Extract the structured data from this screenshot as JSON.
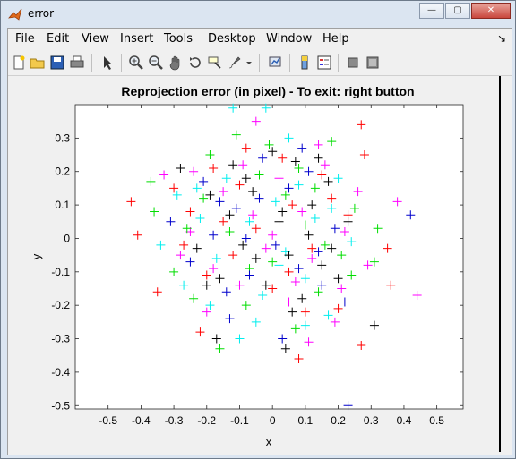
{
  "window": {
    "title": "error"
  },
  "title_buttons": {
    "minimize": "—",
    "maximize": "▢",
    "close": "✕"
  },
  "menu": [
    "File",
    "Edit",
    "View",
    "Insert",
    "Tools",
    "Desktop",
    "Window",
    "Help"
  ],
  "menu_arrow": "↘",
  "toolbar": {
    "tools": [
      "new-figure-icon",
      "open-icon",
      "save-icon",
      "print-icon",
      "pointer-icon",
      "zoom-in-icon",
      "zoom-out-icon",
      "pan-icon",
      "rotate-icon",
      "data-cursor-icon",
      "brush-icon",
      "link-icon",
      "colorbar-icon",
      "legend-icon",
      "hide-plot-tools-icon",
      "show-plot-tools-icon"
    ]
  },
  "chart_data": {
    "type": "scatter",
    "title": "Reprojection error (in pixel) - To exit: right button",
    "xlabel": "x",
    "ylabel": "y",
    "xlim": [
      -0.6,
      0.58
    ],
    "ylim": [
      -0.51,
      0.4
    ],
    "xticks": [
      "-0.5",
      "-0.4",
      "-0.3",
      "-0.2",
      "-0.1",
      "0",
      "0.1",
      "0.2",
      "0.3",
      "0.4",
      "0.5"
    ],
    "xtick_values": [
      -0.5,
      -0.4,
      -0.3,
      -0.2,
      -0.1,
      0,
      0.1,
      0.2,
      0.3,
      0.4,
      0.5
    ],
    "yticks": [
      "0.3",
      "0.2",
      "0.1",
      "0",
      "-0.1",
      "-0.2",
      "-0.3",
      "-0.4",
      "-0.5"
    ],
    "ytick_values": [
      0.3,
      0.2,
      0.1,
      0,
      -0.1,
      -0.2,
      -0.3,
      -0.4,
      -0.5
    ],
    "marker": "+",
    "series": [
      {
        "color": "#ff0000",
        "points": [
          [
            -0.43,
            0.11
          ],
          [
            -0.41,
            0.01
          ],
          [
            -0.35,
            -0.16
          ],
          [
            -0.3,
            0.15
          ],
          [
            -0.25,
            0.08
          ],
          [
            -0.2,
            -0.11
          ],
          [
            -0.18,
            0.21
          ],
          [
            -0.12,
            -0.05
          ],
          [
            -0.08,
            0.27
          ],
          [
            -0.05,
            0.03
          ],
          [
            0.0,
            -0.15
          ],
          [
            0.03,
            0.24
          ],
          [
            0.06,
            0.1
          ],
          [
            0.08,
            -0.36
          ],
          [
            0.12,
            -0.03
          ],
          [
            0.15,
            0.19
          ],
          [
            0.2,
            -0.21
          ],
          [
            0.23,
            0.07
          ],
          [
            0.27,
            -0.32
          ],
          [
            0.27,
            0.34
          ],
          [
            0.28,
            0.25
          ],
          [
            0.36,
            -0.14
          ],
          [
            0.35,
            -0.03
          ],
          [
            -0.22,
            -0.28
          ],
          [
            0.18,
            0.12
          ],
          [
            -0.1,
            0.16
          ],
          [
            0.1,
            -0.22
          ],
          [
            -0.27,
            -0.02
          ],
          [
            0.05,
            -0.1
          ],
          [
            -0.15,
            0.05
          ]
        ]
      },
      {
        "color": "#ff00ff",
        "points": [
          [
            -0.33,
            0.19
          ],
          [
            -0.28,
            -0.05
          ],
          [
            -0.24,
            0.2
          ],
          [
            -0.2,
            -0.22
          ],
          [
            -0.15,
            0.14
          ],
          [
            -0.1,
            -0.14
          ],
          [
            -0.06,
            0.07
          ],
          [
            -0.02,
            -0.03
          ],
          [
            0.02,
            0.18
          ],
          [
            0.05,
            -0.19
          ],
          [
            0.09,
            0.08
          ],
          [
            0.12,
            -0.06
          ],
          [
            0.16,
            0.22
          ],
          [
            0.19,
            -0.25
          ],
          [
            0.22,
            0.02
          ],
          [
            0.26,
            0.14
          ],
          [
            0.29,
            -0.08
          ],
          [
            0.38,
            0.11
          ],
          [
            0.44,
            -0.17
          ],
          [
            -0.05,
            0.35
          ],
          [
            0.11,
            -0.31
          ],
          [
            -0.18,
            -0.09
          ],
          [
            0.14,
            0.28
          ],
          [
            0.0,
            0.01
          ],
          [
            -0.09,
            0.22
          ],
          [
            0.07,
            -0.13
          ],
          [
            -0.25,
            0.02
          ],
          [
            0.21,
            -0.15
          ]
        ]
      },
      {
        "color": "#00dd00",
        "points": [
          [
            -0.37,
            0.17
          ],
          [
            -0.36,
            0.08
          ],
          [
            -0.3,
            -0.1
          ],
          [
            -0.26,
            0.03
          ],
          [
            -0.24,
            -0.18
          ],
          [
            -0.21,
            0.12
          ],
          [
            -0.16,
            -0.33
          ],
          [
            -0.13,
            0.02
          ],
          [
            -0.08,
            -0.2
          ],
          [
            -0.04,
            0.19
          ],
          [
            0.0,
            -0.07
          ],
          [
            0.04,
            0.13
          ],
          [
            0.07,
            -0.27
          ],
          [
            0.1,
            0.04
          ],
          [
            0.14,
            -0.16
          ],
          [
            0.18,
            0.29
          ],
          [
            0.21,
            -0.05
          ],
          [
            0.25,
            0.09
          ],
          [
            0.31,
            -0.07
          ],
          [
            0.32,
            0.03
          ],
          [
            -0.11,
            0.31
          ],
          [
            0.16,
            -0.02
          ],
          [
            -0.01,
            0.28
          ],
          [
            0.08,
            0.21
          ],
          [
            -0.19,
            0.25
          ],
          [
            0.24,
            -0.11
          ],
          [
            -0.07,
            -0.09
          ],
          [
            0.13,
            0.15
          ]
        ]
      },
      {
        "color": "#00eeee",
        "points": [
          [
            -0.34,
            -0.02
          ],
          [
            -0.29,
            0.13
          ],
          [
            -0.27,
            -0.14
          ],
          [
            -0.22,
            0.06
          ],
          [
            -0.17,
            -0.06
          ],
          [
            -0.14,
            0.18
          ],
          [
            -0.1,
            -0.3
          ],
          [
            -0.07,
            0.05
          ],
          [
            -0.03,
            -0.17
          ],
          [
            0.01,
            0.11
          ],
          [
            0.04,
            -0.04
          ],
          [
            0.08,
            0.16
          ],
          [
            0.1,
            -0.12
          ],
          [
            0.13,
            0.06
          ],
          [
            0.17,
            -0.23
          ],
          [
            0.2,
            0.18
          ],
          [
            0.24,
            -0.01
          ],
          [
            -0.12,
            0.39
          ],
          [
            -0.02,
            0.39
          ],
          [
            0.1,
            -0.26
          ],
          [
            -0.19,
            -0.2
          ],
          [
            0.05,
            0.3
          ],
          [
            -0.05,
            -0.25
          ],
          [
            0.18,
            0.09
          ],
          [
            -0.23,
            0.15
          ],
          [
            0.02,
            -0.08
          ]
        ]
      },
      {
        "color": "#0000cc",
        "points": [
          [
            -0.31,
            0.05
          ],
          [
            -0.25,
            -0.07
          ],
          [
            -0.21,
            0.17
          ],
          [
            -0.18,
            0.01
          ],
          [
            -0.14,
            -0.16
          ],
          [
            -0.11,
            0.09
          ],
          [
            -0.07,
            -0.11
          ],
          [
            -0.03,
            0.24
          ],
          [
            0.01,
            -0.02
          ],
          [
            0.05,
            0.15
          ],
          [
            0.08,
            -0.09
          ],
          [
            0.11,
            0.2
          ],
          [
            0.15,
            -0.14
          ],
          [
            0.19,
            0.03
          ],
          [
            0.22,
            -0.19
          ],
          [
            0.42,
            0.07
          ],
          [
            0.23,
            -0.5
          ],
          [
            -0.13,
            -0.24
          ],
          [
            0.03,
            -0.3
          ],
          [
            -0.04,
            0.12
          ],
          [
            0.14,
            -0.04
          ],
          [
            -0.16,
            0.11
          ],
          [
            0.09,
            0.27
          ],
          [
            -0.08,
            0.0
          ]
        ]
      },
      {
        "color": "#000000",
        "points": [
          [
            -0.28,
            0.21
          ],
          [
            -0.23,
            -0.03
          ],
          [
            -0.19,
            0.13
          ],
          [
            -0.16,
            -0.12
          ],
          [
            -0.12,
            0.22
          ],
          [
            -0.09,
            -0.02
          ],
          [
            -0.06,
            0.14
          ],
          [
            -0.02,
            -0.14
          ],
          [
            0.02,
            0.05
          ],
          [
            0.05,
            -0.05
          ],
          [
            0.07,
            0.23
          ],
          [
            0.09,
            -0.18
          ],
          [
            0.12,
            0.1
          ],
          [
            0.15,
            -0.08
          ],
          [
            0.17,
            0.17
          ],
          [
            0.2,
            -0.12
          ],
          [
            0.23,
            0.05
          ],
          [
            0.31,
            -0.26
          ],
          [
            0.04,
            -0.33
          ],
          [
            -0.17,
            -0.3
          ],
          [
            0.0,
            0.26
          ],
          [
            -0.05,
            -0.06
          ],
          [
            0.11,
            0.01
          ],
          [
            -0.13,
            0.07
          ],
          [
            0.06,
            -0.22
          ],
          [
            0.14,
            0.24
          ],
          [
            -0.2,
            -0.14
          ],
          [
            0.03,
            0.08
          ],
          [
            -0.08,
            0.18
          ],
          [
            0.18,
            -0.03
          ]
        ]
      }
    ]
  }
}
